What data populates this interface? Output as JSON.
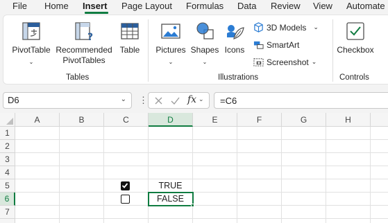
{
  "tabs": [
    {
      "label": "File",
      "active": false
    },
    {
      "label": "Home",
      "active": false
    },
    {
      "label": "Insert",
      "active": true
    },
    {
      "label": "Page Layout",
      "active": false
    },
    {
      "label": "Formulas",
      "active": false
    },
    {
      "label": "Data",
      "active": false
    },
    {
      "label": "Review",
      "active": false
    },
    {
      "label": "View",
      "active": false
    },
    {
      "label": "Automate",
      "active": false
    }
  ],
  "ribbon": {
    "tables": {
      "pivottable": "PivotTable",
      "recommended_line1": "Recommended",
      "recommended_line2": "PivotTables",
      "table": "Table",
      "group_label": "Tables"
    },
    "illustrations": {
      "pictures": "Pictures",
      "shapes": "Shapes",
      "icons": "Icons",
      "models_3d": "3D Models",
      "smartart": "SmartArt",
      "screenshot": "Screenshot",
      "group_label": "Illustrations"
    },
    "controls": {
      "checkbox": "Checkbox",
      "group_label": "Controls"
    }
  },
  "formula_bar": {
    "name_box": "D6",
    "fx": "fx",
    "formula": "=C6"
  },
  "sheet": {
    "columns": [
      "A",
      "B",
      "C",
      "D",
      "E",
      "F",
      "G",
      "H"
    ],
    "rows": [
      "1",
      "2",
      "3",
      "4",
      "5",
      "6",
      "7"
    ],
    "selected_column": "D",
    "selected_row": "6",
    "cells": {
      "D5": "TRUE",
      "D6": "FALSE"
    },
    "checkboxes": {
      "C5": true,
      "C6": false
    }
  },
  "colors": {
    "accent": "#107c41"
  }
}
